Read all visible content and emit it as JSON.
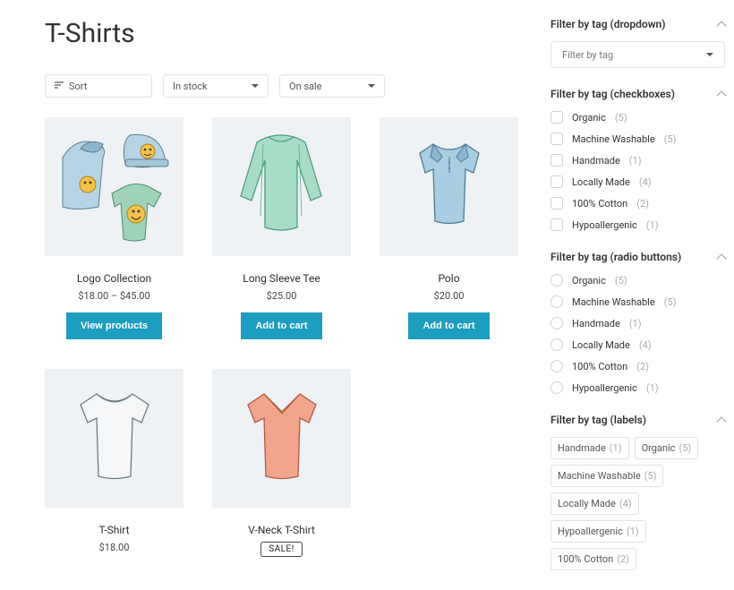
{
  "title": "T-Shirts",
  "toolbar": {
    "sort_label": "Sort",
    "stock_label": "In stock",
    "sale_label": "On sale"
  },
  "products": [
    {
      "name": "Logo Collection",
      "price": "$18.00 – $45.00",
      "cta": "View products"
    },
    {
      "name": "Long Sleeve Tee",
      "price": "$25.00",
      "cta": "Add to cart"
    },
    {
      "name": "Polo",
      "price": "$20.00",
      "cta": "Add to cart"
    },
    {
      "name": "T-Shirt",
      "price": "$18.00",
      "cta": ""
    },
    {
      "name": "V-Neck T-Shirt",
      "price": "",
      "sale": "SALE!",
      "cta": ""
    }
  ],
  "sidebar": {
    "dropdown": {
      "title": "Filter by tag (dropdown)",
      "placeholder": "Filter by tag"
    },
    "checkboxes": {
      "title": "Filter by tag (checkboxes)"
    },
    "radios": {
      "title": "Filter by tag (radio buttons)"
    },
    "labels": {
      "title": "Filter by tag (labels)"
    },
    "tags": [
      {
        "label": "Organic",
        "count": 5
      },
      {
        "label": "Machine Washable",
        "count": 5
      },
      {
        "label": "Handmade",
        "count": 1
      },
      {
        "label": "Locally Made",
        "count": 4
      },
      {
        "label": "100% Cotton",
        "count": 2
      },
      {
        "label": "Hypoallergenic",
        "count": 1
      }
    ],
    "label_order": [
      2,
      0,
      1,
      3,
      5,
      4
    ]
  },
  "colors": {
    "accent": "#1d9dbf"
  }
}
